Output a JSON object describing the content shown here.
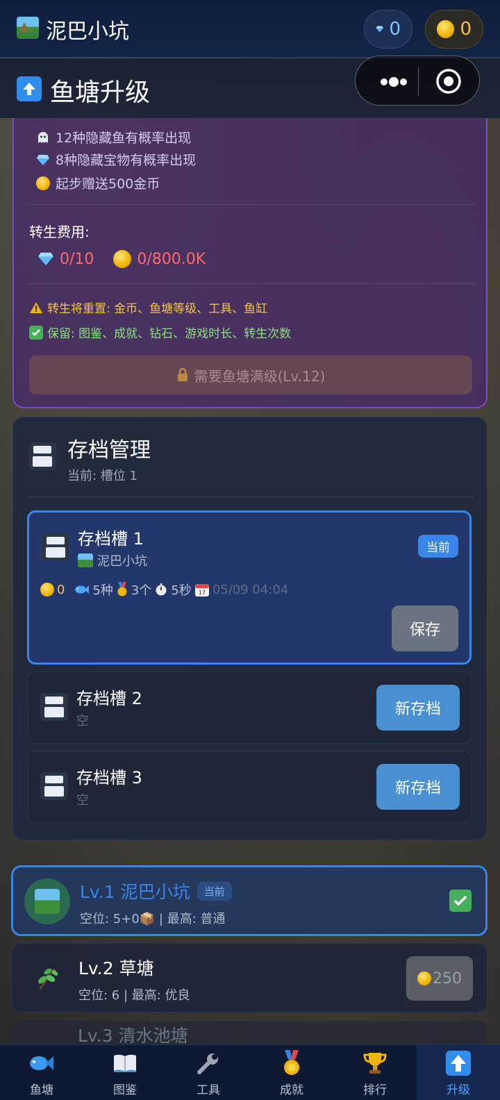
{
  "app": {
    "title": "泥巴小坑",
    "diamonds": "0",
    "coins": "0"
  },
  "page": {
    "title": "鱼塘升级"
  },
  "rebirth": {
    "perks": [
      "12种隐藏鱼有概率出现",
      "8种隐藏宝物有概率出现",
      "起步赠送500金币"
    ],
    "cost_label": "转生费用:",
    "cost_diamond": "0/10",
    "cost_coin": "0/800.0K",
    "warning": "转生将重置: 金币、鱼塘等级、工具、鱼缸",
    "keep": "保留: 图鉴、成就、钻石、游戏时长、转生次数",
    "locked_button": "需要鱼塘满级(Lv.12)"
  },
  "saves": {
    "title": "存档管理",
    "current": "当前: 槽位 1",
    "slots": [
      {
        "name": "存档槽 1",
        "pond": "泥巴小坑",
        "badge": "当前",
        "coins": "0",
        "fish": "5种",
        "medals": "3个",
        "time": "5秒",
        "date": "05/09 04:04",
        "button": "保存"
      },
      {
        "name": "存档槽 2",
        "status": "空",
        "button": "新存档"
      },
      {
        "name": "存档槽 3",
        "status": "空",
        "button": "新存档"
      }
    ]
  },
  "levels": [
    {
      "title": "Lv.1 泥巴小坑",
      "tag": "当前",
      "sub": "空位: 5+0📦 | 最高: 普通"
    },
    {
      "title": "Lv.2 草塘",
      "sub": "空位: 6 | 最高: 优良",
      "cost": "250"
    },
    {
      "title": "Lv.3 清水池塘"
    }
  ],
  "tabs": [
    {
      "label": "鱼塘",
      "icon": "fish-icon"
    },
    {
      "label": "图鉴",
      "icon": "book-icon"
    },
    {
      "label": "工具",
      "icon": "wrench-icon"
    },
    {
      "label": "成就",
      "icon": "medal-icon"
    },
    {
      "label": "排行",
      "icon": "trophy-icon"
    },
    {
      "label": "升级",
      "icon": "upgrade-icon",
      "active": true
    }
  ]
}
